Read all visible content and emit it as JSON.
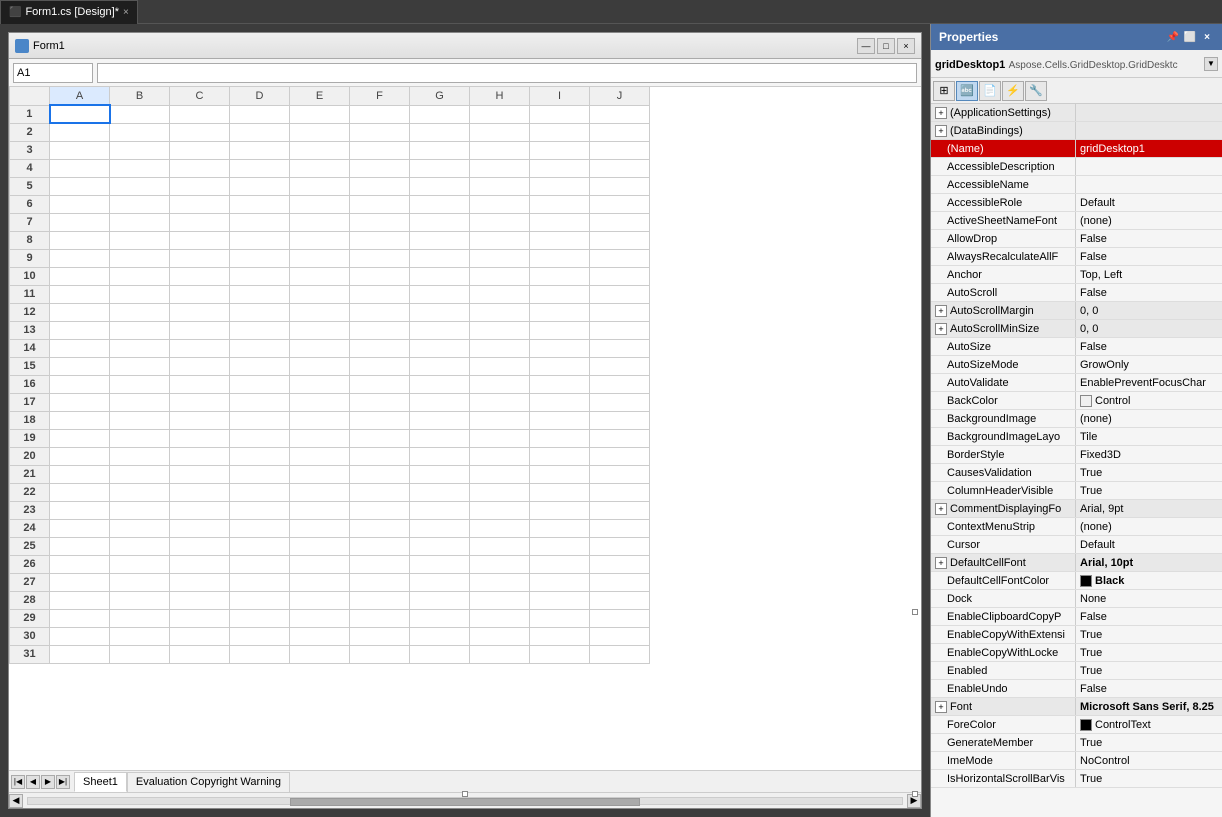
{
  "tab": {
    "label": "Form1.cs [Design]*",
    "close": "×"
  },
  "form": {
    "title": "Form1",
    "icon": "form-icon"
  },
  "toolbar": {
    "cell_ref": "A1",
    "formula_value": ""
  },
  "grid": {
    "columns": [
      "A",
      "B",
      "C",
      "D",
      "E",
      "F",
      "G",
      "H",
      "I",
      "J"
    ],
    "rows": [
      1,
      2,
      3,
      4,
      5,
      6,
      7,
      8,
      9,
      10,
      11,
      12,
      13,
      14,
      15,
      16,
      17,
      18,
      19,
      20,
      21,
      22,
      23,
      24,
      25,
      26,
      27,
      28,
      29,
      30,
      31
    ]
  },
  "sheets": {
    "tabs": [
      "Sheet1",
      "Evaluation Copyright Warning"
    ]
  },
  "properties": {
    "title": "Properties",
    "object_name": "gridDesktop1",
    "object_type": "Aspose.Cells.GridDesktop.GridDesktc",
    "items": [
      {
        "name": "(ApplicationSettings)",
        "value": "",
        "type": "section",
        "expandable": true
      },
      {
        "name": "(DataBindings)",
        "value": "",
        "type": "section",
        "expandable": true
      },
      {
        "name": "(Name)",
        "value": "gridDesktop1",
        "type": "highlighted"
      },
      {
        "name": "AccessibleDescription",
        "value": "",
        "type": "normal"
      },
      {
        "name": "AccessibleName",
        "value": "",
        "type": "normal"
      },
      {
        "name": "AccessibleRole",
        "value": "Default",
        "type": "normal"
      },
      {
        "name": "ActiveSheetNameFont",
        "value": "(none)",
        "type": "normal"
      },
      {
        "name": "AllowDrop",
        "value": "False",
        "type": "normal"
      },
      {
        "name": "AlwaysRecalculateAllF",
        "value": "False",
        "type": "normal"
      },
      {
        "name": "Anchor",
        "value": "Top, Left",
        "type": "normal"
      },
      {
        "name": "AutoScroll",
        "value": "False",
        "type": "normal"
      },
      {
        "name": "AutoScrollMargin",
        "value": "0, 0",
        "type": "section",
        "expandable": true
      },
      {
        "name": "AutoScrollMinSize",
        "value": "0, 0",
        "type": "section",
        "expandable": true
      },
      {
        "name": "AutoSize",
        "value": "False",
        "type": "normal"
      },
      {
        "name": "AutoSizeMode",
        "value": "GrowOnly",
        "type": "normal"
      },
      {
        "name": "AutoValidate",
        "value": "EnablePreventFocusChar",
        "type": "normal"
      },
      {
        "name": "BackColor",
        "value": "Control",
        "type": "color",
        "color": "#f0f0f0"
      },
      {
        "name": "BackgroundImage",
        "value": "(none)",
        "type": "normal"
      },
      {
        "name": "BackgroundImageLayo",
        "value": "Tile",
        "type": "normal"
      },
      {
        "name": "BorderStyle",
        "value": "Fixed3D",
        "type": "normal"
      },
      {
        "name": "CausesValidation",
        "value": "True",
        "type": "normal"
      },
      {
        "name": "ColumnHeaderVisible",
        "value": "True",
        "type": "normal"
      },
      {
        "name": "CommentDisplayingFo",
        "value": "Arial, 9pt",
        "type": "section",
        "expandable": true
      },
      {
        "name": "ContextMenuStrip",
        "value": "(none)",
        "type": "normal"
      },
      {
        "name": "Cursor",
        "value": "Default",
        "type": "normal"
      },
      {
        "name": "DefaultCellFont",
        "value": "Arial, 10pt",
        "type": "section_bold",
        "expandable": true
      },
      {
        "name": "DefaultCellFontColor",
        "value": "Black",
        "type": "color_bold",
        "color": "#000000"
      },
      {
        "name": "Dock",
        "value": "None",
        "type": "normal"
      },
      {
        "name": "EnableClipboardCopyP",
        "value": "False",
        "type": "normal"
      },
      {
        "name": "EnableCopyWithExtensi",
        "value": "True",
        "type": "normal"
      },
      {
        "name": "EnableCopyWithLocke",
        "value": "True",
        "type": "normal"
      },
      {
        "name": "Enabled",
        "value": "True",
        "type": "normal"
      },
      {
        "name": "EnableUndo",
        "value": "False",
        "type": "normal"
      },
      {
        "name": "Font",
        "value": "Microsoft Sans Serif, 8.25",
        "type": "section_bold",
        "expandable": true
      },
      {
        "name": "ForeColor",
        "value": "ControlText",
        "type": "color",
        "color": "#000000"
      },
      {
        "name": "GenerateMember",
        "value": "True",
        "type": "normal"
      },
      {
        "name": "ImeMode",
        "value": "NoControl",
        "type": "normal"
      },
      {
        "name": "IsHorizontalScrollBarVis",
        "value": "True",
        "type": "bold"
      }
    ]
  }
}
